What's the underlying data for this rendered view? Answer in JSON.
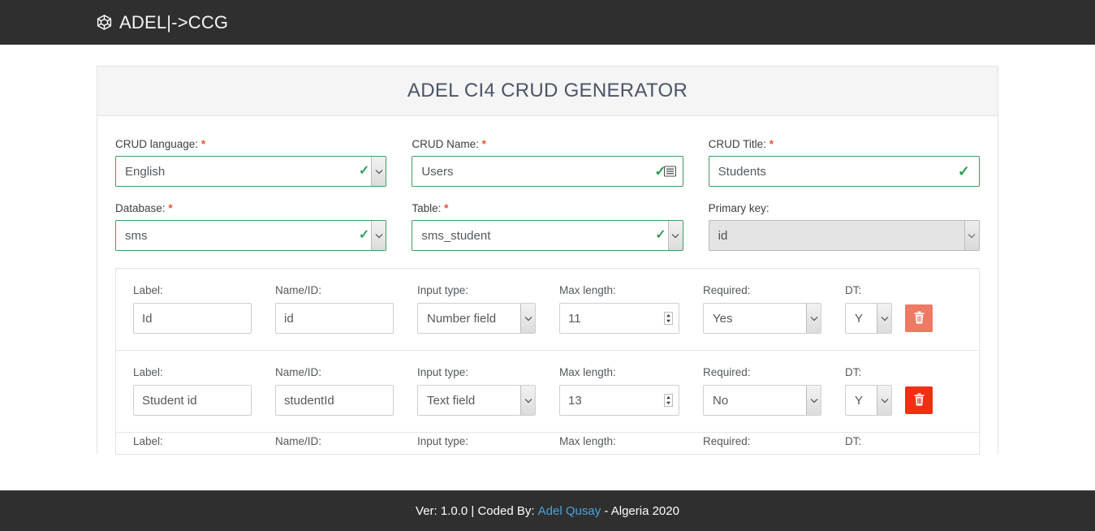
{
  "navbar": {
    "brand_text": "ADEL|->CCG",
    "brand_icon": "cube-icon",
    "bg_color": "#2f2f2f"
  },
  "card": {
    "title": "ADEL CI4 CRUD GENERATOR"
  },
  "form": {
    "required_marker": "*",
    "fields": [
      {
        "label": "CRUD language:",
        "required": true,
        "control": "select",
        "value": "English",
        "state": "valid",
        "icon": "green-check-icon"
      },
      {
        "label": "CRUD Name:",
        "required": true,
        "control": "text",
        "value": "Users",
        "state": "valid",
        "icon": "autofill-list-icon"
      },
      {
        "label": "CRUD Title:",
        "required": true,
        "control": "text",
        "value": "Students",
        "state": "valid",
        "icon": "green-check-icon"
      },
      {
        "label": "Database:",
        "required": true,
        "control": "select",
        "value": "sms",
        "state": "valid",
        "icon": "green-check-icon"
      },
      {
        "label": "Table:",
        "required": true,
        "control": "select",
        "value": "sms_student",
        "state": "valid",
        "icon": "green-check-icon"
      },
      {
        "label": "Primary key:",
        "required": false,
        "control": "select",
        "value": "id",
        "state": "disabled",
        "icon": "chevron-down-icon"
      }
    ]
  },
  "field_rows": {
    "column_labels": {
      "label": "Label:",
      "name_id": "Name/ID:",
      "input_type": "Input type:",
      "max_length": "Max length:",
      "required": "Required:",
      "dt": "DT:"
    },
    "rows": [
      {
        "label": "Id",
        "name_id": "id",
        "input_type": "Number field",
        "max_length": "11",
        "required": "Yes",
        "dt": "Y",
        "delete_icon": "trash-icon",
        "delete_color": "#ef7a63"
      },
      {
        "label": "Student id",
        "name_id": "studentId",
        "input_type": "Text field",
        "max_length": "13",
        "required": "No",
        "dt": "Y",
        "delete_icon": "trash-icon",
        "delete_color": "#f02f13"
      }
    ]
  },
  "footer": {
    "version_text": "Ver: 1.0.0 | Coded By:",
    "author_link": "Adel Qusay",
    "suffix_text": "- Algeria 2020"
  }
}
